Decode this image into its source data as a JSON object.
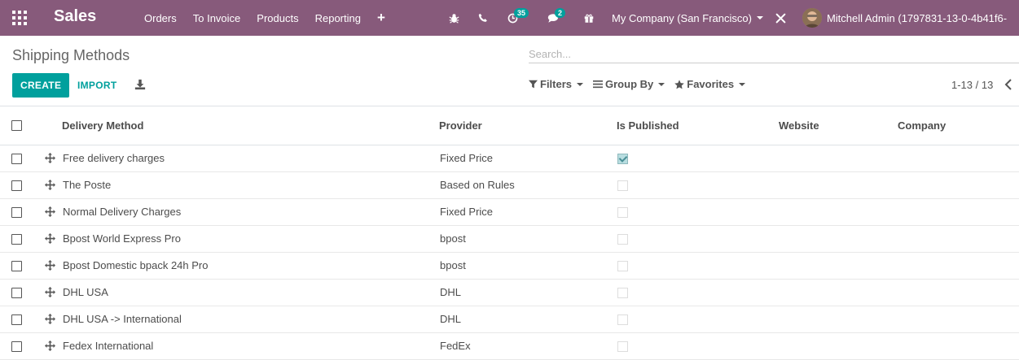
{
  "navbar": {
    "brand": "Sales",
    "menu": [
      "Orders",
      "To Invoice",
      "Products",
      "Reporting"
    ],
    "plus": "+",
    "activity_badge": "35",
    "message_badge": "2",
    "company": "My Company (San Francisco)",
    "user": "Mitchell Admin (1797831-13-0-4b41f6-",
    "color": "#875a7b"
  },
  "control_panel": {
    "title": "Shipping Methods",
    "search_placeholder": "Search...",
    "create_label": "CREATE",
    "import_label": "IMPORT",
    "filters_label": "Filters",
    "groupby_label": "Group By",
    "favorites_label": "Favorites",
    "pager": "1-13 / 13",
    "accent": "#00a09d"
  },
  "table": {
    "headers": [
      "Delivery Method",
      "Provider",
      "Is Published",
      "Website",
      "Company"
    ],
    "rows": [
      {
        "method": "Free delivery charges",
        "provider": "Fixed Price",
        "published": true
      },
      {
        "method": "The Poste",
        "provider": "Based on Rules",
        "published": false
      },
      {
        "method": "Normal Delivery Charges",
        "provider": "Fixed Price",
        "published": false
      },
      {
        "method": "Bpost World Express Pro",
        "provider": "bpost",
        "published": false
      },
      {
        "method": "Bpost Domestic bpack 24h Pro",
        "provider": "bpost",
        "published": false
      },
      {
        "method": "DHL USA",
        "provider": "DHL",
        "published": false
      },
      {
        "method": "DHL USA -> International",
        "provider": "DHL",
        "published": false
      },
      {
        "method": "Fedex International",
        "provider": "FedEx",
        "published": false
      }
    ]
  }
}
